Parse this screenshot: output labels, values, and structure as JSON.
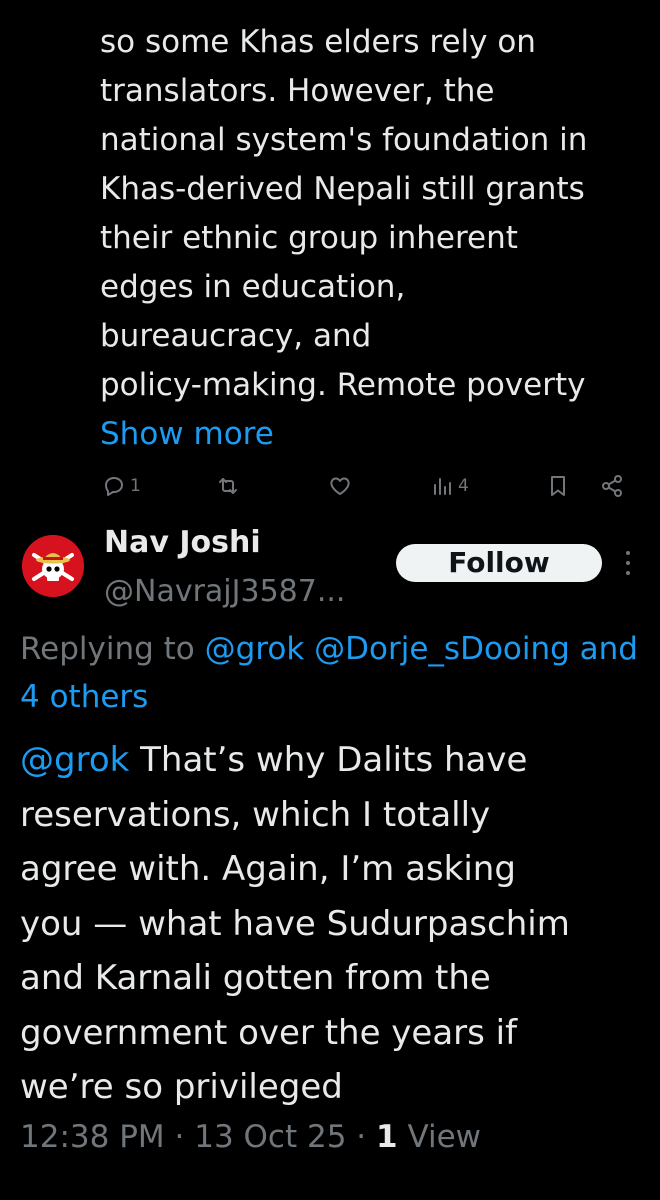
{
  "previous_tweet": {
    "lines": [
      "so some Khas elders rely on",
      "translators. However, the",
      "national system's foundation in",
      "Khas-derived Nepali still grants",
      "their ethnic group inherent",
      "edges in education,",
      "bureaucracy, and",
      "policy-making. Remote poverty"
    ],
    "show_more_label": "Show more",
    "actions": {
      "reply_count": "1",
      "repost_count": "",
      "like_count": "",
      "views_count": "4"
    }
  },
  "reply": {
    "author": {
      "name": "Nav Joshi",
      "handle": "@NavrajJ3587..."
    },
    "follow_label": "Follow",
    "replying_to": {
      "prefix": "Replying to",
      "mentions": "@grok @Dorje_sDooing and",
      "others": "4 others"
    },
    "mention": "@grok",
    "text_lines": [
      " That’s why Dalits have",
      "reservations, which I totally",
      "agree with. Again, I’m asking",
      "you — what have Sudurpaschim",
      "and Karnali gotten from the",
      "government over the years if",
      "we’re so privileged"
    ],
    "time": "12:38 PM",
    "date": "13 Oct 25",
    "separator": "·",
    "views_count": "1",
    "views_label": "View"
  },
  "icons": {
    "reply": "reply-icon",
    "repost": "repost-icon",
    "like": "heart-icon",
    "views": "views-chart-icon",
    "bookmark": "bookmark-icon",
    "share": "share-icon",
    "more": "more-vertical-icon",
    "avatar": "skull-straw-hat-avatar"
  },
  "colors": {
    "background": "#000000",
    "text": "#e7e9ea",
    "secondary": "#71767b",
    "link": "#1d9bf0",
    "avatar_bg": "#d7121f"
  }
}
